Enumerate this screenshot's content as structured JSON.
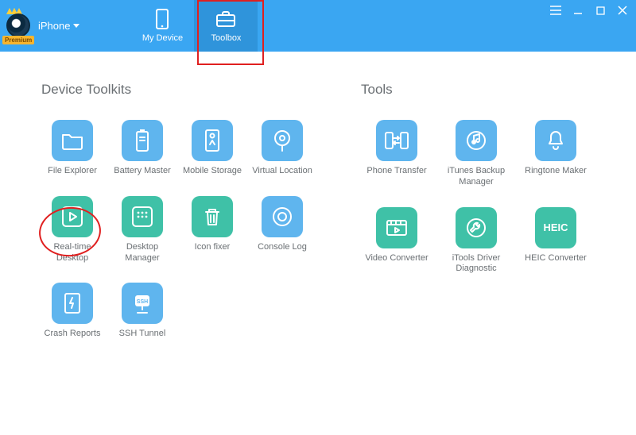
{
  "brand": {
    "premium_label": "Premium",
    "device_dropdown": "iPhone"
  },
  "nav": {
    "my_device": "My Device",
    "toolbox": "Toolbox"
  },
  "sections": {
    "device_toolkits_title": "Device Toolkits",
    "tools_title": "Tools"
  },
  "toolkits": [
    {
      "label": "File Explorer",
      "color": "blue",
      "icon": "folder-icon"
    },
    {
      "label": "Battery Master",
      "color": "blue",
      "icon": "battery-icon"
    },
    {
      "label": "Mobile Storage",
      "color": "blue",
      "icon": "storage-icon"
    },
    {
      "label": "Virtual Location",
      "color": "blue",
      "icon": "location-icon"
    },
    {
      "label": "Real-time Desktop",
      "color": "teal",
      "icon": "play-icon"
    },
    {
      "label": "Desktop Manager",
      "color": "teal",
      "icon": "grid-icon"
    },
    {
      "label": "Icon fixer",
      "color": "teal",
      "icon": "trash-icon"
    },
    {
      "label": "Console Log",
      "color": "blue",
      "icon": "console-icon"
    },
    {
      "label": "Crash Reports",
      "color": "blue",
      "icon": "crash-icon"
    },
    {
      "label": "SSH Tunnel",
      "color": "blue",
      "icon": "ssh-icon"
    }
  ],
  "tools": [
    {
      "label": "Phone Transfer",
      "color": "blue",
      "icon": "transfer-icon"
    },
    {
      "label": "iTunes Backup Manager",
      "color": "blue",
      "icon": "itunes-icon"
    },
    {
      "label": "Ringtone Maker",
      "color": "blue",
      "icon": "bell-icon"
    },
    {
      "label": "Video Converter",
      "color": "teal",
      "icon": "video-icon"
    },
    {
      "label": "iTools Driver Diagnostic",
      "color": "teal",
      "icon": "wrench-icon"
    },
    {
      "label": "HEIC Converter",
      "color": "teal",
      "icon": "heic-icon",
      "text": "HEIC"
    }
  ],
  "colors": {
    "blue": "#5fb5ee",
    "teal": "#3fc1a7",
    "header": "#3aa6f2",
    "header_active": "#2f94db"
  }
}
